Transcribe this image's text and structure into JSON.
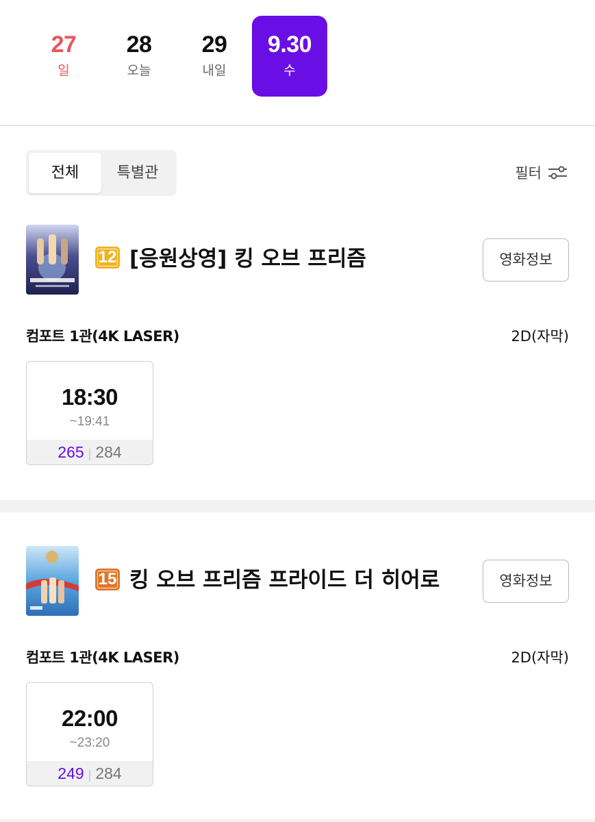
{
  "dates": [
    {
      "num": "27",
      "day": "일"
    },
    {
      "num": "28",
      "day": "오늘"
    },
    {
      "num": "29",
      "day": "내일"
    },
    {
      "num": "9.30",
      "day": "수"
    }
  ],
  "tabs": {
    "all": "전체",
    "special": "특별관"
  },
  "filter": {
    "label": "필터",
    "icon": "filter-sliders-icon"
  },
  "colors": {
    "accent": "#6a0ee6",
    "sunday": "#e9555c",
    "rating12": "#f0b323",
    "rating15": "#e0762a"
  },
  "movies": [
    {
      "rating": "12",
      "title": "[응원상영] 킹 오브 프리즘",
      "info_label": "영화정보",
      "hall": "컴포트 1관(4K LASER)",
      "format": "2D(자막)",
      "showtime": {
        "start": "18:30",
        "end": "~19:41",
        "available": "265",
        "sep": "|",
        "total": "284"
      }
    },
    {
      "rating": "15",
      "title": "킹 오브 프리즘 프라이드 더 히어로",
      "info_label": "영화정보",
      "hall": "컴포트 1관(4K LASER)",
      "format": "2D(자막)",
      "showtime": {
        "start": "22:00",
        "end": "~23:20",
        "available": "249",
        "sep": "|",
        "total": "284"
      }
    }
  ]
}
